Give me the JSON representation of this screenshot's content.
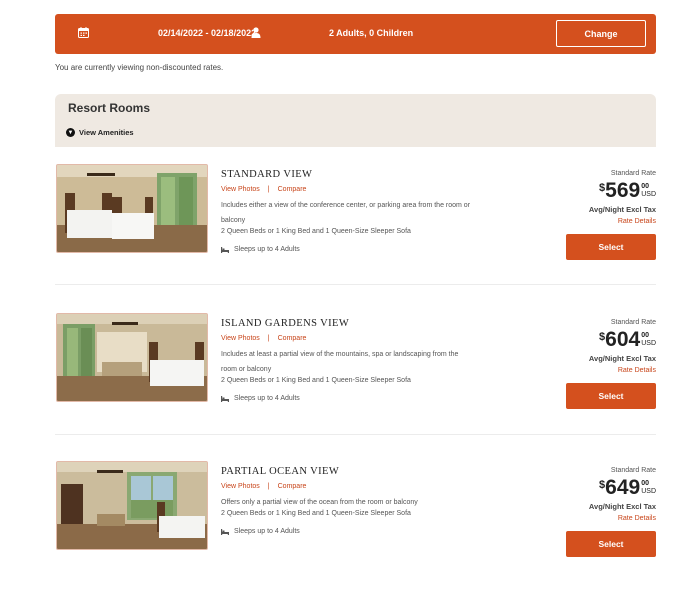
{
  "search_bar": {
    "dates": "02/14/2022 - 02/18/2022",
    "guests": "2 Adults, 0 Children",
    "change_label": "Change"
  },
  "rate_note": "You are currently viewing non-discounted rates.",
  "section": {
    "title": "Resort Rooms",
    "amenities_label": "View Amenities"
  },
  "rooms": [
    {
      "name": "STANDARD VIEW",
      "view_photos": "View Photos",
      "compare": "Compare",
      "description": "Includes either a view of the conference center, or parking area from the room or balcony",
      "beds": "2 Queen Beds or 1 King Bed and 1 Queen-Size Sleeper Sofa",
      "sleeps": "Sleeps up to 4 Adults",
      "rate_label": "Standard Rate",
      "currency": "$",
      "price": "569",
      "cents": "00",
      "currency_code": "USD",
      "avg_label": "Avg/Night Excl Tax",
      "rate_details": "Rate Details",
      "select_label": "Select"
    },
    {
      "name": "ISLAND GARDENS VIEW",
      "view_photos": "View Photos",
      "compare": "Compare",
      "description": "Includes at least a partial view of the mountains, spa or landscaping from the room or balcony",
      "beds": "2 Queen Beds or 1 King Bed and 1 Queen-Size Sleeper Sofa",
      "sleeps": "Sleeps up to 4 Adults",
      "rate_label": "Standard Rate",
      "currency": "$",
      "price": "604",
      "cents": "00",
      "currency_code": "USD",
      "avg_label": "Avg/Night Excl Tax",
      "rate_details": "Rate Details",
      "select_label": "Select"
    },
    {
      "name": "PARTIAL OCEAN VIEW",
      "view_photos": "View Photos",
      "compare": "Compare",
      "description": "Offers only a partial view of the ocean from the room or balcony",
      "beds": "2 Queen Beds or 1 King Bed and 1 Queen-Size Sleeper Sofa",
      "sleeps": "Sleeps up to 4 Adults",
      "rate_label": "Standard Rate",
      "currency": "$",
      "price": "649",
      "cents": "00",
      "currency_code": "USD",
      "avg_label": "Avg/Night Excl Tax",
      "rate_details": "Rate Details",
      "select_label": "Select"
    }
  ],
  "colors": {
    "accent": "#d4501e",
    "link": "#c8451a",
    "section_bg": "#efe9e2"
  }
}
